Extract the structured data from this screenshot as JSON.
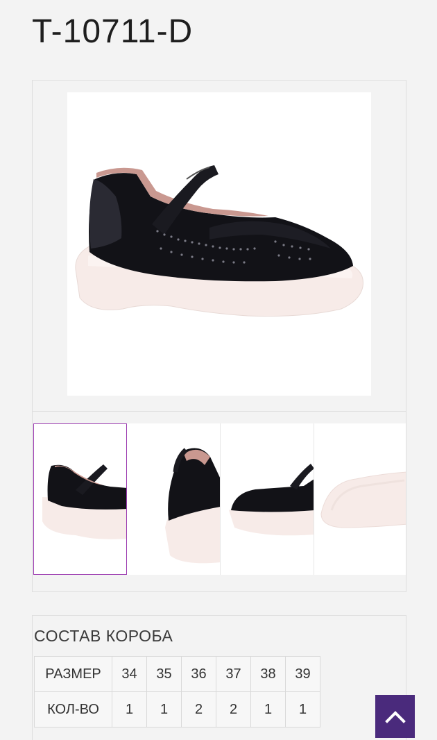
{
  "product": {
    "title": "T-10711-D"
  },
  "gallery": {
    "main_image": "black-perforated-mary-jane-shoe-on-white-platform",
    "thumbnails": [
      {
        "name": "side-view"
      },
      {
        "name": "back-view"
      },
      {
        "name": "three-quarter-view"
      },
      {
        "name": "sole-view"
      }
    ],
    "selected_index": 0
  },
  "box": {
    "title": "СОСТАВ КОРОБА",
    "size_label": "РАЗМЕР",
    "qty_label": "КОЛ-ВО",
    "sizes": [
      "34",
      "35",
      "36",
      "37",
      "38",
      "39"
    ],
    "quantities": [
      "1",
      "1",
      "2",
      "2",
      "1",
      "1"
    ]
  },
  "scroll_top": {
    "icon": "chevron-up-icon"
  },
  "colors": {
    "accent": "#4a2a7c",
    "selected_border": "#9b3ab0"
  }
}
